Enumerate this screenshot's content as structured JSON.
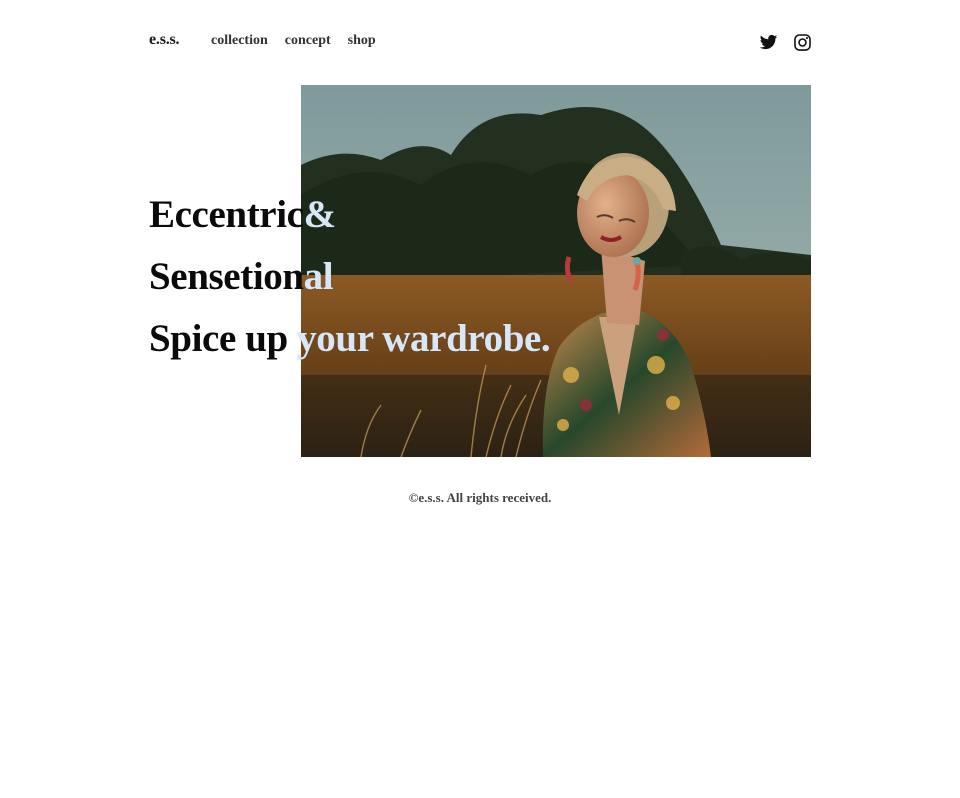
{
  "header": {
    "logo": "e.s.s.",
    "nav": [
      {
        "label": "collection"
      },
      {
        "label": "concept"
      },
      {
        "label": "shop"
      }
    ],
    "social": [
      {
        "icon": "twitter-icon"
      },
      {
        "icon": "instagram-icon"
      }
    ]
  },
  "hero": {
    "headline": [
      "Eccentric&",
      "Sensetional",
      "Spice up your wardrobe."
    ],
    "overlap_text_color": "#d9e6f5",
    "image_subject": "woman-portrait-in-field"
  },
  "footer": {
    "text": "©e.s.s. All rights received."
  },
  "colors": {
    "text": "#0a0a0a",
    "nav_text": "#333333",
    "background": "#ffffff"
  }
}
